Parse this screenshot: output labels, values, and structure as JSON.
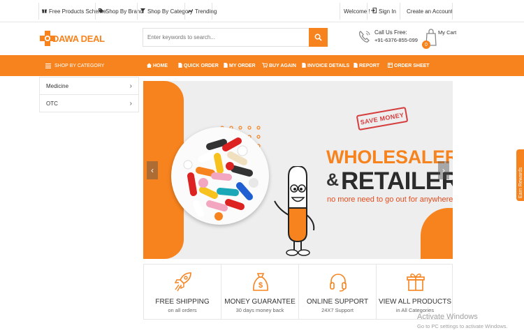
{
  "topbar": {
    "free_products": "Free Products Scheme",
    "shop_by_brand": "Shop By Brand",
    "shop_by_category": "Shop By Category",
    "trending": "Trending",
    "welcome": "Welcome !",
    "sign_in": "Sign In",
    "create_account": "Create an Account"
  },
  "header": {
    "logo_text": "DAWA DEAL",
    "search_placeholder": "Enter keywords to search...",
    "phone_label": "Call Us Free:",
    "phone_number": "+91-6376-855-099",
    "cart_label": "My Cart",
    "cart_count": "0"
  },
  "nav": {
    "category_label": "SHOP BY CATEGORY",
    "items": [
      "HOME",
      "QUICK ORDER",
      "MY ORDER",
      "BUY AGAIN",
      "INVOICE DETAILS",
      "REPORT",
      "ORDER SHEET"
    ]
  },
  "sidebar": {
    "items": [
      "Medicine",
      "OTC"
    ]
  },
  "banner": {
    "stamp": "SAVE MONEY",
    "headline_1": "WHOLESALER",
    "headline_amp": "&",
    "headline_2": "RETAILER",
    "subline": "no more need to go out for anywhere",
    "prev_arrow": "‹",
    "next_arrow": "›"
  },
  "features": [
    {
      "title": "FREE SHIPPING",
      "subtitle": "on all orders",
      "icon": "rocket-icon"
    },
    {
      "title": "MONEY GUARANTEE",
      "subtitle": "30 days money back",
      "icon": "money-bag-icon"
    },
    {
      "title": "ONLINE SUPPORT",
      "subtitle": "24X7 Support",
      "icon": "headset-icon"
    },
    {
      "title": "VIEW ALL PRODUCTS",
      "subtitle": "in All Categories",
      "icon": "gift-icon"
    }
  ],
  "rewards_tab": "Earn Rewards",
  "watermark": {
    "title": "Activate Windows",
    "subtitle": "Go to PC settings to activate Windows."
  },
  "colors": {
    "accent": "#f7831e",
    "stamp_red": "#d63d3d",
    "subline_red": "#e34c1c"
  }
}
